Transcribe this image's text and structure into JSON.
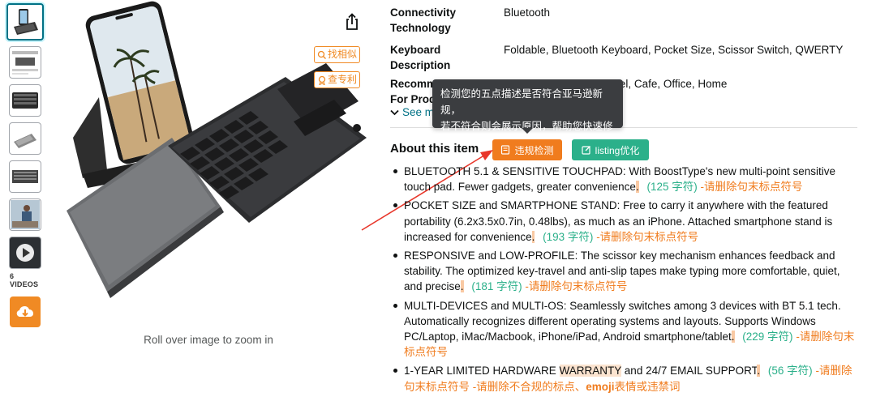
{
  "thumbnails": {
    "videos_label": "6 VIDEOS"
  },
  "main_image": {
    "zoom_text": "Roll over image to zoom in"
  },
  "side_buttons": {
    "find_similar": "找相似",
    "check_patent": "查专利"
  },
  "specs": [
    {
      "label": "Connectivity Technology",
      "value": "Bluetooth"
    },
    {
      "label": "Keyboard Description",
      "value": "Foldable, Bluetooth Keyboard, Pocket Size, Scissor Switch, QWERTY"
    },
    {
      "label": "Recommended Uses For Product",
      "value": "Travel, Conference, Hotel, Cafe, Office, Home"
    }
  ],
  "see_more": "See more",
  "tooltip": {
    "line1": "检测您的五点描述是否符合亚马逊新规，",
    "line2": "若不符合则会展示原因，帮助您快速修改!"
  },
  "about": {
    "title": "About this item",
    "check_button": "违规检测",
    "listing_button": "listing优化"
  },
  "bullets": [
    {
      "text": "BLUETOOTH 5.1 & SENSITIVE TOUCHPAD: With BoostType's new multi-point sensitive touch pad. Fewer gadgets, greater convenience",
      "end": ".",
      "count": "(125 字符)",
      "warning": "-请删除句末标点符号"
    },
    {
      "text": "POCKET SIZE and SMARTPHONE STAND: Free to carry it anywhere with the featured portability (6.2x3.5x0.7in, 0.48lbs), as much as an iPhone. Attached smartphone stand is increased for convenience",
      "end": ".",
      "count": "(193 字符)",
      "warning": "-请删除句末标点符号"
    },
    {
      "text": "RESPONSIVE and LOW-PROFILE: The scissor key mechanism enhances feedback and stability. The optimized key-travel and anti-slip tapes make typing more comfortable, quiet, and precise",
      "end": ".",
      "count": "(181 字符)",
      "warning": "-请删除句末标点符号"
    },
    {
      "text": "MULTI-DEVICES and MULTI-OS: Seamlessly switches among 3 devices with BT 5.1 tech. Automatically recognizes different operating systems and layouts. Supports Windows PC/Laptop, iMac/Macbook, iPhone/iPad, Android smartphone/tablet",
      "end": ".",
      "count": "(229 字符)",
      "warning": "-请删除句末标点符号"
    },
    {
      "text_before": "1-YEAR LIMITED HARDWARE ",
      "highlight": "WARRANTY",
      "text_after": " and 24/7 EMAIL SUPPORT",
      "end": ".",
      "count": "(56 字符)",
      "warning": "-请删除句末标点符号",
      "warning2_prefix": " -请删除不合规的标点、",
      "warning2_bold": "emoji",
      "warning2_suffix": "表情或违禁词"
    }
  ],
  "colors": {
    "accent_orange": "#f07c1e",
    "accent_green": "#2bb08a",
    "link_teal": "#007185",
    "tooltip_bg": "#3b3d40"
  }
}
